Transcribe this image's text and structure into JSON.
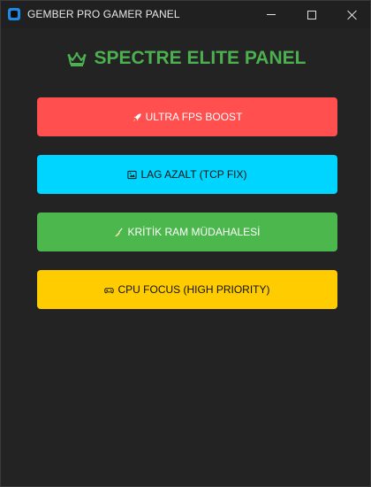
{
  "window": {
    "title": "GEMBER PRO GAMER PANEL"
  },
  "heading": {
    "text": "SPECTRE ELITE PANEL",
    "icon": "crown-icon",
    "color": "#4caf50"
  },
  "buttons": [
    {
      "label": "ULTRA FPS BOOST",
      "icon": "rocket-icon",
      "color": "#ff4f4f"
    },
    {
      "label": "LAG AZALT (TCP FIX)",
      "icon": "globe-icon",
      "color": "#00d5ff"
    },
    {
      "label": "KRİTİK RAM MÜDAHALESİ",
      "icon": "broom-icon",
      "color": "#4cb74c"
    },
    {
      "label": "CPU FOCUS (HIGH PRIORITY)",
      "icon": "gamepad-icon",
      "color": "#ffcc00"
    }
  ]
}
